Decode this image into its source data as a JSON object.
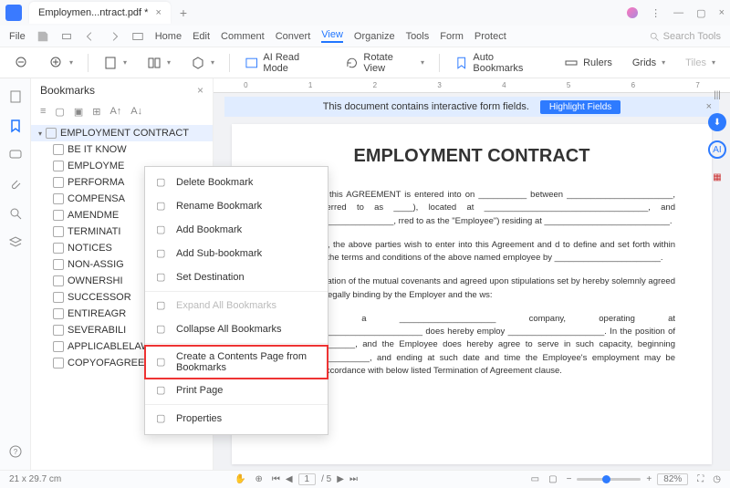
{
  "titlebar": {
    "tab": "Employmen...ntract.pdf *"
  },
  "menu": {
    "file": "File",
    "items": [
      "Home",
      "Edit",
      "Comment",
      "Convert",
      "View",
      "Organize",
      "Tools",
      "Form",
      "Protect"
    ],
    "active": "View",
    "search_ph": "Search Tools"
  },
  "toolbar": {
    "ai_read": "AI Read Mode",
    "rotate": "Rotate View",
    "auto_bm": "Auto Bookmarks",
    "rulers": "Rulers",
    "grids": "Grids",
    "tiles": "Tiles"
  },
  "bookmarks_panel": {
    "title": "Bookmarks",
    "root": "EMPLOYMENT CONTRACT",
    "items": [
      "BE IT KNOW",
      "EMPLOYME",
      "PERFORMA",
      "COMPENSA",
      "AMENDME",
      "TERMINATI",
      "NOTICES",
      "NON-ASSIG",
      "OWNERSHI",
      "SUCCESSOR",
      "ENTIREAGR",
      "SEVERABILI",
      "APPLICABLELAW",
      "COPYOFAGREEMENT"
    ]
  },
  "ruler_ticks": [
    "0",
    "1",
    "2",
    "3",
    "4",
    "5",
    "6",
    "7"
  ],
  "banner": {
    "msg": "This document contains interactive form fields.",
    "btn": "Highlight Fields"
  },
  "page": {
    "title": "EMPLOYMENT CONTRACT",
    "p1": "KNOWN , that this AGREEMENT is entered into on __________ between ______________________, (hereafter referred to as ____), located at __________________________________, and __________________________, rred to as the \"Employee\") residing at __________________________.",
    "p2": "SS THEREOF , the above parties wish to enter into this Agreement and d to define and set forth within this instrument the terms and conditions of the above named employee by ______________________.",
    "p3": "RE, in consideration of the mutual covenants and agreed upon stipulations set by hereby solemnly agreed upon and thus legally binding by the Employer and the ws:",
    "p4": "____________: a ____________________ company, operating at ________________________________ does hereby employ ____________________. In the position of __________________, and the Employee does hereby agree to serve in such capacity, beginning _____________________, and ending at such date and time the Employee's employment may be terminated in accordance with below listed Termination of Agreement clause."
  },
  "context_menu": {
    "items": [
      {
        "label": "Delete Bookmark",
        "enabled": true
      },
      {
        "label": "Rename Bookmark",
        "enabled": true
      },
      {
        "label": "Add Bookmark",
        "enabled": true
      },
      {
        "label": "Add Sub-bookmark",
        "enabled": true
      },
      {
        "label": "Set Destination",
        "enabled": true
      },
      {
        "sep": true
      },
      {
        "label": "Expand All Bookmarks",
        "enabled": false
      },
      {
        "label": "Collapse All Bookmarks",
        "enabled": true
      },
      {
        "sep": true
      },
      {
        "label": "Create a Contents Page from Bookmarks",
        "enabled": true,
        "highlight": true
      },
      {
        "label": "Print Page",
        "enabled": true
      },
      {
        "sep": true
      },
      {
        "label": "Properties",
        "enabled": true
      }
    ]
  },
  "status": {
    "dims": "21 x 29.7 cm",
    "page_cur": "1",
    "page_total": "/ 5",
    "zoom": "82%"
  }
}
